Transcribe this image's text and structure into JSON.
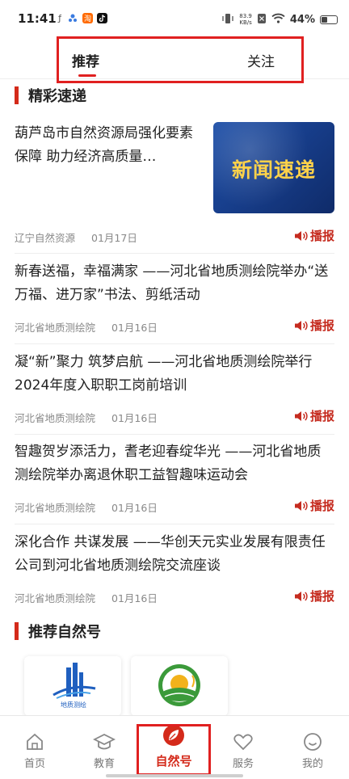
{
  "status_bar": {
    "time": "11:41",
    "speed_value": "83.9",
    "speed_unit": "KB/s",
    "battery_pct": "44%",
    "battery_level": 0.44
  },
  "top_tabs": {
    "recommend": "推荐",
    "follow": "关注",
    "active": "recommend"
  },
  "section_highlights": {
    "title": "精彩速递"
  },
  "news": [
    {
      "headline": "葫芦岛市自然资源局强化要素保障 助力经济高质量…",
      "source": "辽宁自然资源",
      "date": "01月17日",
      "broadcast_label": "播报",
      "thumbnail_text": "新闻速递"
    },
    {
      "headline": "新春送福，幸福满家 ——河北省地质测绘院举办“送万福、进万家”书法、剪纸活动",
      "source": "河北省地质测绘院",
      "date": "01月16日",
      "broadcast_label": "播报"
    },
    {
      "headline": "凝“新”聚力 筑梦启航 ——河北省地质测绘院举行2024年度入职职工岗前培训",
      "source": "河北省地质测绘院",
      "date": "01月16日",
      "broadcast_label": "播报"
    },
    {
      "headline": "智趣贺岁添活力，耆老迎春绽华光 ——河北省地质测绘院举办离退休职工益智趣味运动会",
      "source": "河北省地质测绘院",
      "date": "01月16日",
      "broadcast_label": "播报"
    },
    {
      "headline": "深化合作 共谋发展 ——华创天元实业发展有限责任公司到河北省地质测绘院交流座谈",
      "source": "河北省地质测绘院",
      "date": "01月16日",
      "broadcast_label": "播报"
    }
  ],
  "section_recommended": {
    "title": "推荐自然号"
  },
  "recommended_accounts": [
    {
      "logo_text": "地质测绘",
      "icon": "building-logo-icon"
    },
    {
      "icon": "farm-sun-logo-icon"
    }
  ],
  "bottom_nav": [
    {
      "label": "首页",
      "icon": "home-icon"
    },
    {
      "label": "教育",
      "icon": "graduation-cap-icon"
    },
    {
      "label": "自然号",
      "icon": "leaf-icon",
      "active": true
    },
    {
      "label": "服务",
      "icon": "heart-icon"
    },
    {
      "label": "我的",
      "icon": "smiley-icon"
    }
  ],
  "colors": {
    "accent_red": "#d42a1a",
    "highlight_box": "#e02020",
    "thumbnail_blue": "#1d4fa8",
    "thumbnail_text": "#ffd24a"
  }
}
